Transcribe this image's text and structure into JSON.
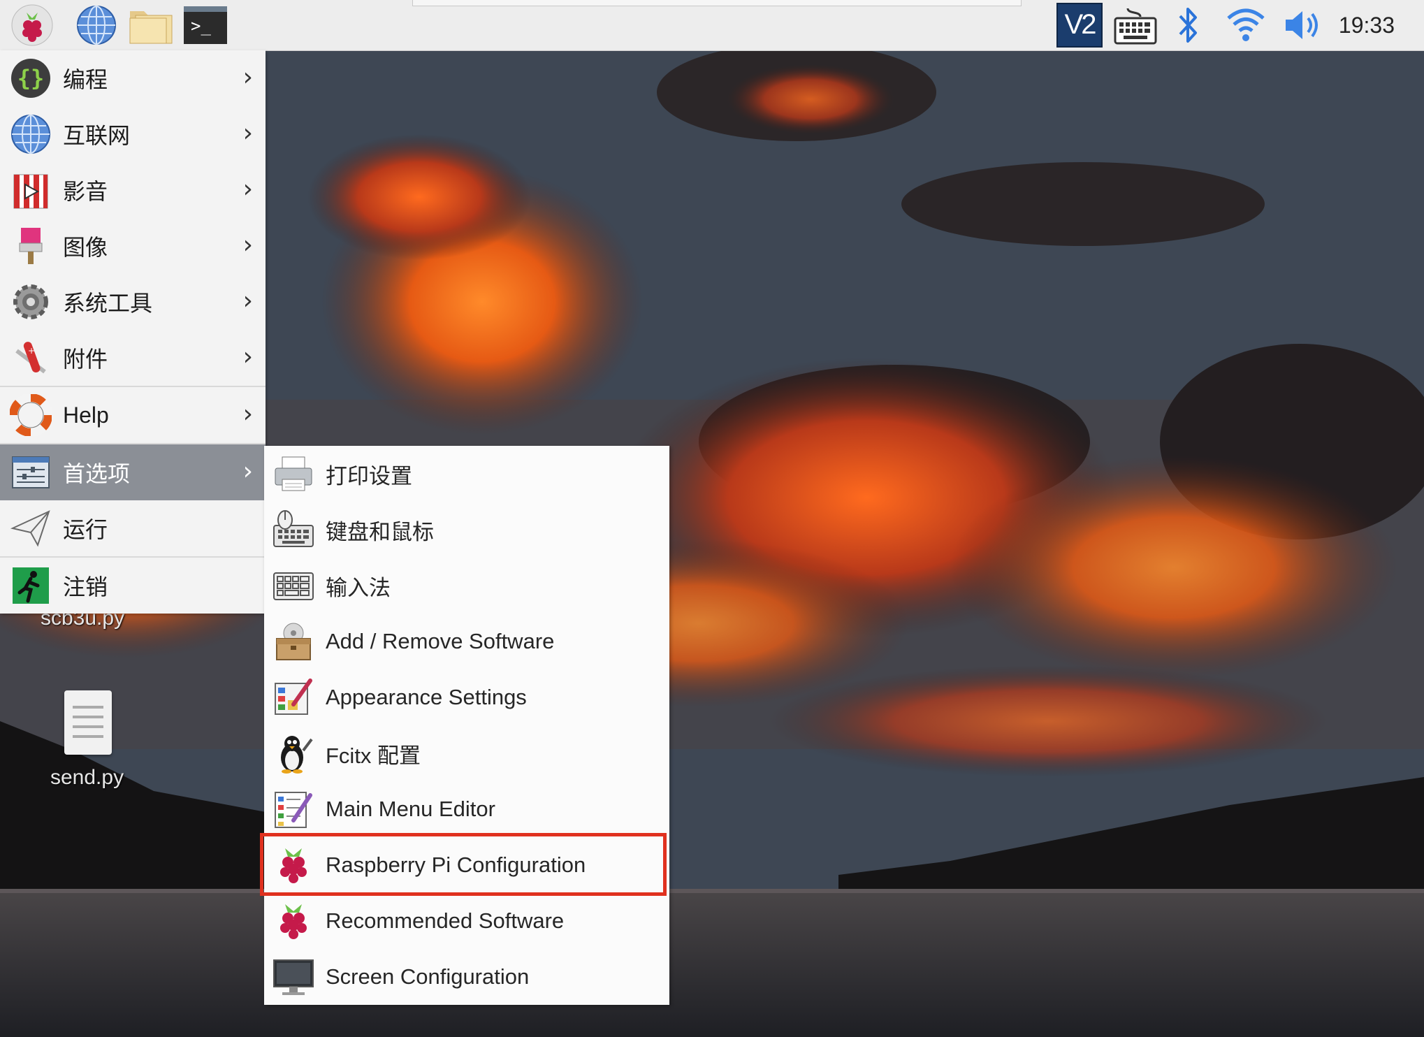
{
  "taskbar": {
    "launchers": [
      "raspberry-menu",
      "web-browser",
      "file-manager",
      "terminal"
    ],
    "terminal_glyph": ">_",
    "tray": [
      "vnc",
      "keyboard",
      "bluetooth",
      "wifi",
      "volume"
    ],
    "vnc_label": "V2",
    "clock": "19:33"
  },
  "main_menu": {
    "items": [
      {
        "label": "编程",
        "icon": "programming-icon"
      },
      {
        "label": "互联网",
        "icon": "internet-icon"
      },
      {
        "label": "影音",
        "icon": "sound-video-icon"
      },
      {
        "label": "图像",
        "icon": "graphics-icon"
      },
      {
        "label": "系统工具",
        "icon": "system-tools-icon"
      },
      {
        "label": "附件",
        "icon": "accessories-icon"
      },
      {
        "label": "Help",
        "icon": "help-icon"
      },
      {
        "label": "首选项",
        "icon": "preferences-icon"
      },
      {
        "label": "运行",
        "icon": "run-icon"
      },
      {
        "label": "注销",
        "icon": "logout-icon"
      }
    ],
    "chevron": "›",
    "active_index": 7
  },
  "submenu": {
    "items": [
      {
        "label": "打印设置",
        "icon": "printer-icon"
      },
      {
        "label": "键盘和鼠标",
        "icon": "keyboard-mouse-icon"
      },
      {
        "label": "输入法",
        "icon": "input-method-icon"
      },
      {
        "label": "Add / Remove Software",
        "icon": "software-box-icon"
      },
      {
        "label": "Appearance Settings",
        "icon": "appearance-icon"
      },
      {
        "label": "Fcitx 配置",
        "icon": "penguin-icon"
      },
      {
        "label": "Main Menu Editor",
        "icon": "menu-editor-icon"
      },
      {
        "label": "Raspberry Pi Configuration",
        "icon": "raspberry-icon"
      },
      {
        "label": "Recommended Software",
        "icon": "raspberry-icon"
      },
      {
        "label": "Screen Configuration",
        "icon": "monitor-icon"
      }
    ],
    "highlighted_index": 7,
    "highlight_color": "#e0311f"
  },
  "desktop": {
    "icons": [
      {
        "label": "scb3u.py"
      },
      {
        "label": "send.py"
      }
    ]
  },
  "colors": {
    "panel": "#ededed",
    "menu_bg": "#f3f3f3",
    "active_item": "#8b8f96",
    "raspberry_red": "#c51a4a",
    "leaf_green": "#6cc04a"
  }
}
